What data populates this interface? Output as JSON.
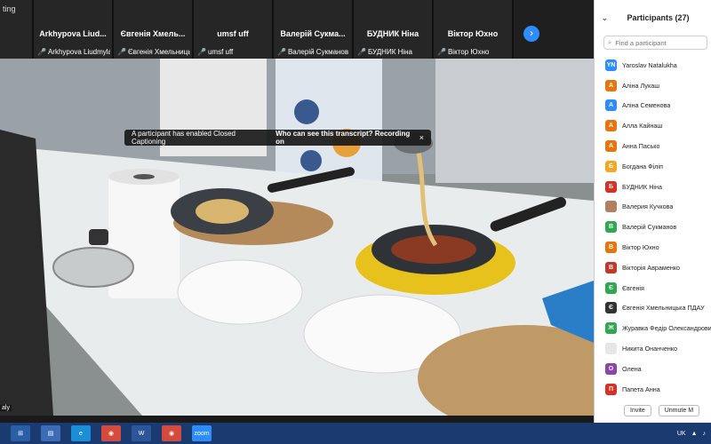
{
  "video": {
    "corner_label": "ting",
    "self_label": "aly",
    "caption_banner": {
      "message": "A participant has enabled Closed Captioning",
      "link": "Who can see this transcript? Recording on",
      "close": "×"
    },
    "next_arrow": "›"
  },
  "tiles": [
    {
      "name": "Arkhypova Liud...",
      "sub": "Arkhypova Liudmyla"
    },
    {
      "name": "Євгенія Хмель...",
      "sub": "Євгенія Хмельницьк..."
    },
    {
      "name": "umsf uff",
      "sub": "umsf uff"
    },
    {
      "name": "Валерій Сукма...",
      "sub": "Валерій Сукманов"
    },
    {
      "name": "БУДНИК Ніна",
      "sub": "БУДНИК Ніна"
    },
    {
      "name": "Віктор Юхно",
      "sub": "Віктор Юхно"
    }
  ],
  "panel": {
    "collapse_icon": "⌄",
    "title": "Participants (27)",
    "search_placeholder": "Find a participant",
    "participants": [
      {
        "initials": "YN",
        "name": "Yaroslav Natalukha",
        "color": "#2d8cff"
      },
      {
        "initials": "A",
        "name": "Аліна Лукаш",
        "color": "#e8740c"
      },
      {
        "initials": "A",
        "name": "Аліна Семенова",
        "color": "#2d8cff"
      },
      {
        "initials": "A",
        "name": "Алла Кайнаш",
        "color": "#e8740c"
      },
      {
        "initials": "A",
        "name": "Анна Пасько",
        "color": "#e8740c"
      },
      {
        "initials": "Б",
        "name": "Богдана Філіп",
        "color": "#f5a623"
      },
      {
        "initials": "Б",
        "name": "БУДНИК Ніна",
        "color": "#d93025"
      },
      {
        "initials": "",
        "name": "Валерия Кучкова",
        "color": "#b08060"
      },
      {
        "initials": "В",
        "name": "Валерій Сукманов",
        "color": "#2fa84f"
      },
      {
        "initials": "В",
        "name": "Віктор Юхно",
        "color": "#e8740c"
      },
      {
        "initials": "В",
        "name": "Вікторія Авраменко",
        "color": "#c0392b"
      },
      {
        "initials": "Є",
        "name": "Євгенія",
        "color": "#2fa84f"
      },
      {
        "initials": "Є",
        "name": "Євгенія Хмельницька ПДАУ",
        "color": "#333333"
      },
      {
        "initials": "Ж",
        "name": "Журавка Федір Олександрович",
        "color": "#2fa84f"
      },
      {
        "initials": "",
        "name": "Никита Онанченко",
        "color": "#e6e6e6"
      },
      {
        "initials": "О",
        "name": "Олена",
        "color": "#8e44ad"
      },
      {
        "initials": "П",
        "name": "Папета Анна",
        "color": "#d93025"
      }
    ],
    "invite_label": "Invite",
    "unmute_label": "Unmute M"
  },
  "taskbar": {
    "lang": "UK",
    "zoom_label": "zoom"
  }
}
